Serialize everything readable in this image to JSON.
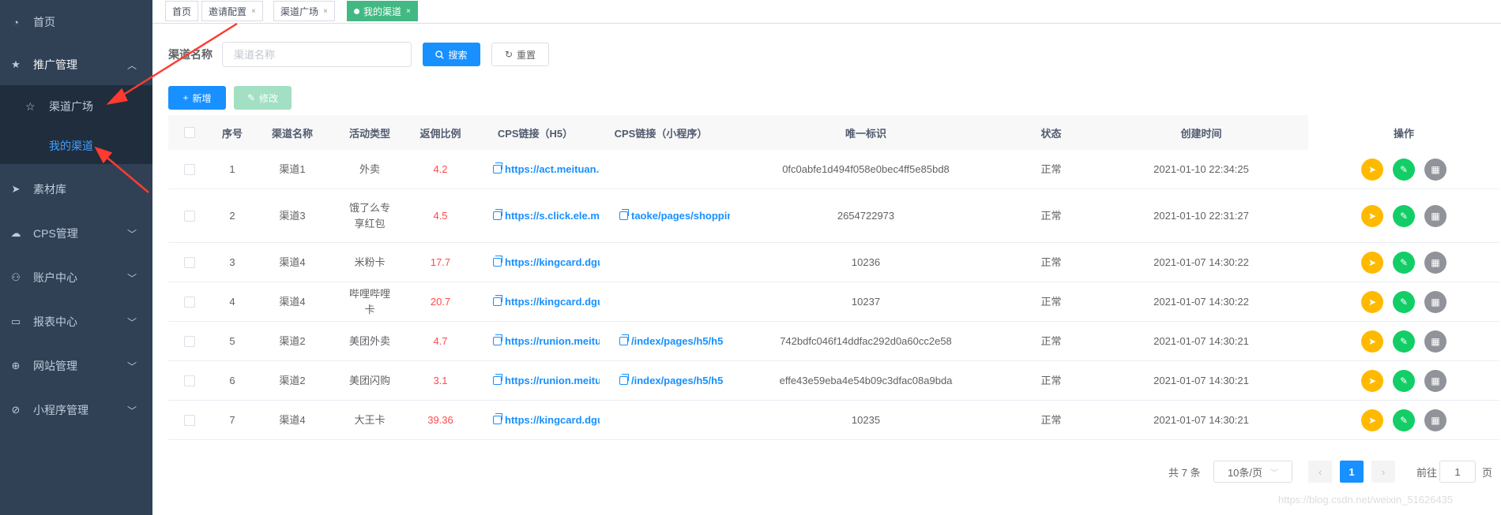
{
  "sidebar": {
    "items": [
      {
        "label": "首页",
        "icon": "dashboard-icon",
        "glyph": "◔",
        "arrow": ""
      },
      {
        "label": "推广管理",
        "icon": "star-icon",
        "glyph": "★",
        "arrow": "︿"
      },
      {
        "label": "素材库",
        "icon": "send-icon",
        "glyph": "➤",
        "arrow": ""
      },
      {
        "label": "CPS管理",
        "icon": "cloud-icon",
        "glyph": "☁",
        "arrow": "﹀"
      },
      {
        "label": "账户中心",
        "icon": "user-icon",
        "glyph": "⚇",
        "arrow": "﹀"
      },
      {
        "label": "报表中心",
        "icon": "monitor-icon",
        "glyph": "▭",
        "arrow": "﹀"
      },
      {
        "label": "网站管理",
        "icon": "globe-icon",
        "glyph": "⊕",
        "arrow": "﹀"
      },
      {
        "label": "小程序管理",
        "icon": "compass-icon",
        "glyph": "⊘",
        "arrow": "﹀"
      }
    ],
    "subitems": [
      {
        "label": "渠道广场",
        "icon": "star-outline-icon",
        "glyph": "☆"
      },
      {
        "label": "我的渠道",
        "icon": "",
        "glyph": ""
      }
    ]
  },
  "tabs": [
    {
      "label": "首页",
      "close": ""
    },
    {
      "label": "邀请配置",
      "close": "×"
    },
    {
      "label": "渠道广场",
      "close": "×"
    },
    {
      "label": "我的渠道",
      "close": "×"
    }
  ],
  "search": {
    "label": "渠道名称",
    "placeholder": "渠道名称",
    "search_label": "搜索",
    "reset_label": "重置"
  },
  "toolbar": {
    "add_label": "新增",
    "edit_label": "修改"
  },
  "table": {
    "columns": [
      "序号",
      "渠道名称",
      "活动类型",
      "返佣比例",
      "CPS链接（H5）",
      "CPS链接（小程序）",
      "唯一标识",
      "状态",
      "创建时间",
      "操作"
    ],
    "rows": [
      {
        "no": "1",
        "channel": "渠道1",
        "type": "外卖",
        "ratio": "4.2",
        "h5": "https://act.meituan.c",
        "mp": "",
        "uid": "0fc0abfe1d494f058e0bec4ff5e85bd8",
        "status": "正常",
        "created": "2021-01-10 22:34:25"
      },
      {
        "no": "2",
        "channel": "渠道3",
        "type": "饿了么专享红包",
        "ratio": "4.5",
        "h5": "https://s.click.ele.me",
        "mp": "taoke/pages/shoppir",
        "uid": "2654722973",
        "status": "正常",
        "created": "2021-01-10 22:31:27"
      },
      {
        "no": "3",
        "channel": "渠道4",
        "type": "米粉卡",
        "ratio": "17.7",
        "h5": "https://kingcard.dgu",
        "mp": "",
        "uid": "10236",
        "status": "正常",
        "created": "2021-01-07 14:30:22"
      },
      {
        "no": "4",
        "channel": "渠道4",
        "type": "哔哩哔哩卡",
        "ratio": "20.7",
        "h5": "https://kingcard.dgu",
        "mp": "",
        "uid": "10237",
        "status": "正常",
        "created": "2021-01-07 14:30:22"
      },
      {
        "no": "5",
        "channel": "渠道2",
        "type": "美团外卖",
        "ratio": "4.7",
        "h5": "https://runion.meitu",
        "mp": "/index/pages/h5/h5",
        "uid": "742bdfc046f14ddfac292d0a60cc2e58",
        "status": "正常",
        "created": "2021-01-07 14:30:21"
      },
      {
        "no": "6",
        "channel": "渠道2",
        "type": "美团闪购",
        "ratio": "3.1",
        "h5": "https://runion.meitu",
        "mp": "/index/pages/h5/h5",
        "uid": "effe43e59eba4e54b09c3dfac08a9bda",
        "status": "正常",
        "created": "2021-01-07 14:30:21"
      },
      {
        "no": "7",
        "channel": "渠道4",
        "type": "大王卡",
        "ratio": "39.36",
        "h5": "https://kingcard.dgu",
        "mp": "",
        "uid": "10235",
        "status": "正常",
        "created": "2021-01-07 14:30:21"
      }
    ]
  },
  "pagination": {
    "total": "共 7 条",
    "page_size": "10条/页",
    "current": "1",
    "goto_label": "前往",
    "goto_value": "1",
    "page_suffix": "页",
    "prev": "‹",
    "next": "›"
  },
  "watermark": "https://blog.csdn.net/weixin_51626435",
  "colors": {
    "sidebar_bg": "#304156",
    "primary": "#1890ff",
    "tag_active": "#42b983",
    "danger": "#ff4949",
    "annotation_arrow": "#ff3b30"
  }
}
